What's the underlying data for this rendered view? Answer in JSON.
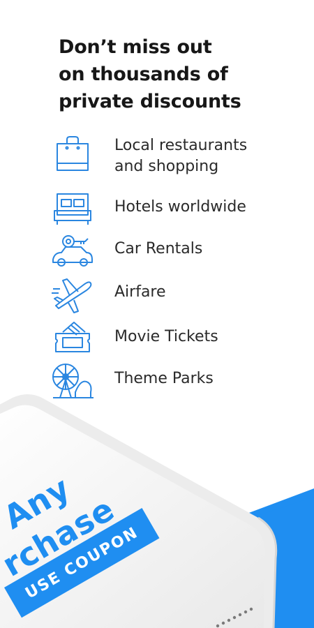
{
  "headline": {
    "line1": "Don’t miss out",
    "line2": "on thousands of",
    "line3": "private discounts"
  },
  "features": [
    {
      "label_line1": "Local restaurants",
      "label_line2": "and shopping",
      "icon": "shopping-bag-icon"
    },
    {
      "label": "Hotels worldwide",
      "icon": "bed-icon"
    },
    {
      "label": "Car Rentals",
      "icon": "car-icon"
    },
    {
      "label": "Airfare",
      "icon": "airplane-icon"
    },
    {
      "label": "Movie Tickets",
      "icon": "ticket-icon"
    },
    {
      "label": "Theme Parks",
      "icon": "ferris-wheel-icon"
    }
  ],
  "phone": {
    "promo_line1": "Any",
    "promo_line2": "rchase",
    "coupon_label": "USE COUPON"
  },
  "colors": {
    "accent": "#1f8ef1",
    "icon_stroke": "#2a86e0",
    "headline_text": "#171717",
    "phone_body": "#f1f1f1"
  }
}
